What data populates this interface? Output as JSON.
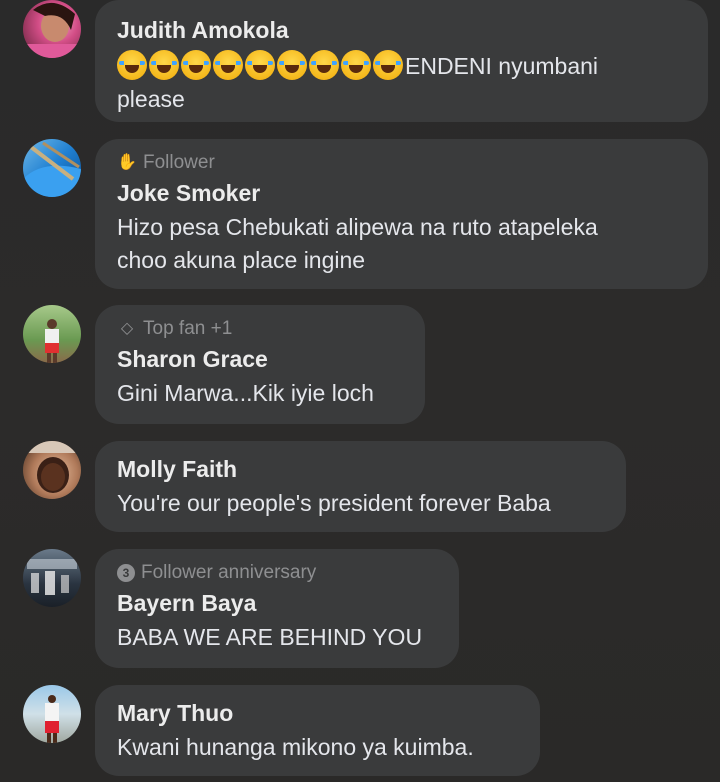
{
  "comments": [
    {
      "avatar_icon": "profile-photo-pink",
      "badge": "",
      "name": "Judith Amokola",
      "emoji_count": 9,
      "text_after_emoji": "ENDENI nyumbani",
      "text_line2": "please"
    },
    {
      "avatar_icon": "profile-photo-blue",
      "badge_icon": "wave-icon",
      "badge": "Follower",
      "name": "Joke Smoker",
      "text_line1": "Hizo pesa Chebukati alipewa na ruto atapeleka",
      "text_line2": "choo akuna place ingine"
    },
    {
      "avatar_icon": "profile-photo-outdoor",
      "badge_icon": "diamond-icon",
      "badge": "Top fan +1",
      "name": "Sharon Grace",
      "text_line1": "Gini Marwa...Kik iyie loch"
    },
    {
      "avatar_icon": "profile-photo-portrait",
      "badge": "",
      "name": "Molly Faith",
      "text_line1": "You're our people's president forever Baba"
    },
    {
      "avatar_icon": "profile-photo-group",
      "badge_icon": "anniversary-icon",
      "badge_icon_glyph": "3",
      "badge": "Follower anniversary",
      "name": "Bayern Baya",
      "text_line1": "BABA WE ARE BEHIND YOU"
    },
    {
      "avatar_icon": "profile-photo-standing",
      "badge": "",
      "name": "Mary Thuo",
      "text_line1": "Kwani hunanga mikono ya kuimba."
    }
  ],
  "colors": {
    "background": "#2b2a29",
    "bubble": "#3a3b3c",
    "name": "#ececec",
    "badge": "#8e8f91"
  }
}
